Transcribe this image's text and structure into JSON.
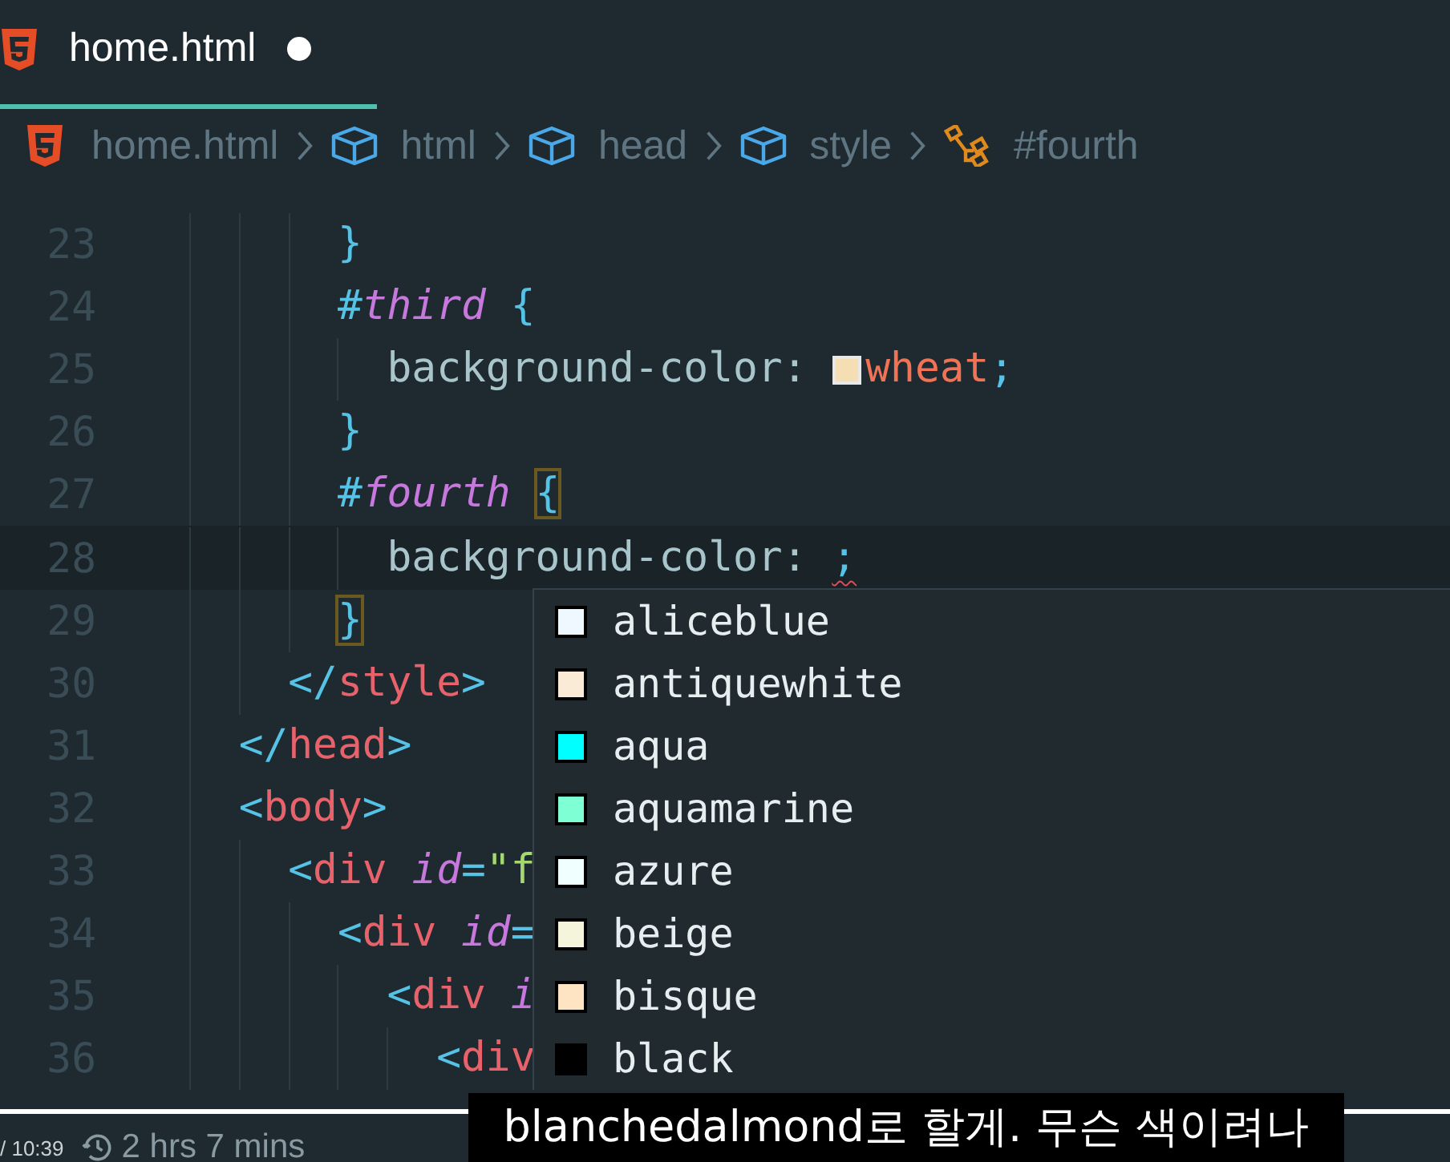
{
  "tab": {
    "title": "home.html",
    "modified": true,
    "selected": true
  },
  "breadcrumb": [
    {
      "kind": "file",
      "label": "home.html"
    },
    {
      "kind": "element",
      "label": "html"
    },
    {
      "kind": "element",
      "label": "head"
    },
    {
      "kind": "element",
      "label": "style"
    },
    {
      "kind": "selector",
      "label": "#fourth"
    }
  ],
  "editor": {
    "lines": [
      {
        "number": "23",
        "current": false,
        "tokens": [
          {
            "kind": "punct",
            "text": "      }"
          }
        ]
      },
      {
        "number": "24",
        "current": false,
        "tokens": [
          {
            "kind": "punct",
            "text": "      #"
          },
          {
            "kind": "selector",
            "text": "third"
          },
          {
            "kind": "punct",
            "text": " {"
          }
        ]
      },
      {
        "number": "25",
        "current": false,
        "tokens": [
          {
            "kind": "prop",
            "text": "        background-color: "
          },
          {
            "kind": "swatch",
            "color": "#f5deb3"
          },
          {
            "kind": "value",
            "text": "wheat"
          },
          {
            "kind": "punct",
            "text": ";"
          }
        ]
      },
      {
        "number": "26",
        "current": false,
        "tokens": [
          {
            "kind": "punct",
            "text": "      }"
          }
        ]
      },
      {
        "number": "27",
        "current": false,
        "tokens": [
          {
            "kind": "punct",
            "text": "      #"
          },
          {
            "kind": "selector",
            "text": "fourth"
          },
          {
            "kind": "punct",
            "text": " {",
            "matched": true
          }
        ]
      },
      {
        "number": "28",
        "current": true,
        "tokens": [
          {
            "kind": "prop",
            "text": "        background-color: "
          },
          {
            "kind": "punct",
            "text": ";",
            "error": true
          }
        ]
      },
      {
        "number": "29",
        "current": false,
        "tokens": [
          {
            "kind": "punct",
            "text": "      }",
            "matched": true
          }
        ]
      },
      {
        "number": "30",
        "current": false,
        "tokens": [
          {
            "kind": "punct",
            "text": "    </"
          },
          {
            "kind": "tag",
            "text": "style"
          },
          {
            "kind": "punct",
            "text": ">"
          }
        ]
      },
      {
        "number": "31",
        "current": false,
        "tokens": [
          {
            "kind": "punct",
            "text": "  </"
          },
          {
            "kind": "tag",
            "text": "head"
          },
          {
            "kind": "punct",
            "text": ">"
          }
        ]
      },
      {
        "number": "32",
        "current": false,
        "tokens": [
          {
            "kind": "punct",
            "text": "  <"
          },
          {
            "kind": "tag",
            "text": "body"
          },
          {
            "kind": "punct",
            "text": ">"
          }
        ]
      },
      {
        "number": "33",
        "current": false,
        "tokens": [
          {
            "kind": "punct",
            "text": "    <"
          },
          {
            "kind": "tag",
            "text": "div"
          },
          {
            "kind": "attr",
            "text": " id"
          },
          {
            "kind": "punct",
            "text": "="
          },
          {
            "kind": "string",
            "text": "\"f"
          }
        ]
      },
      {
        "number": "34",
        "current": false,
        "tokens": [
          {
            "kind": "punct",
            "text": "      <"
          },
          {
            "kind": "tag",
            "text": "div"
          },
          {
            "kind": "attr",
            "text": " id"
          },
          {
            "kind": "punct",
            "text": "="
          }
        ]
      },
      {
        "number": "35",
        "current": false,
        "tokens": [
          {
            "kind": "punct",
            "text": "        <"
          },
          {
            "kind": "tag",
            "text": "div"
          },
          {
            "kind": "attr",
            "text": " i"
          }
        ]
      },
      {
        "number": "36",
        "current": false,
        "tokens": [
          {
            "kind": "punct",
            "text": "          <"
          },
          {
            "kind": "tag",
            "text": "div"
          }
        ]
      }
    ]
  },
  "suggestions": [
    {
      "label": "aliceblue",
      "color": "#f0f8ff"
    },
    {
      "label": "antiquewhite",
      "color": "#faebd7"
    },
    {
      "label": "aqua",
      "color": "#00ffff"
    },
    {
      "label": "aquamarine",
      "color": "#7fffd4"
    },
    {
      "label": "azure",
      "color": "#f0ffff"
    },
    {
      "label": "beige",
      "color": "#f5f5dc"
    },
    {
      "label": "bisque",
      "color": "#ffe4c4"
    },
    {
      "label": "black",
      "color": "#000000"
    }
  ],
  "player": {
    "time": "/ 10:39",
    "remaining": "2 hrs 7 mins",
    "subtitle": "blanchedalmond로 할게. 무슨 색이려나"
  }
}
